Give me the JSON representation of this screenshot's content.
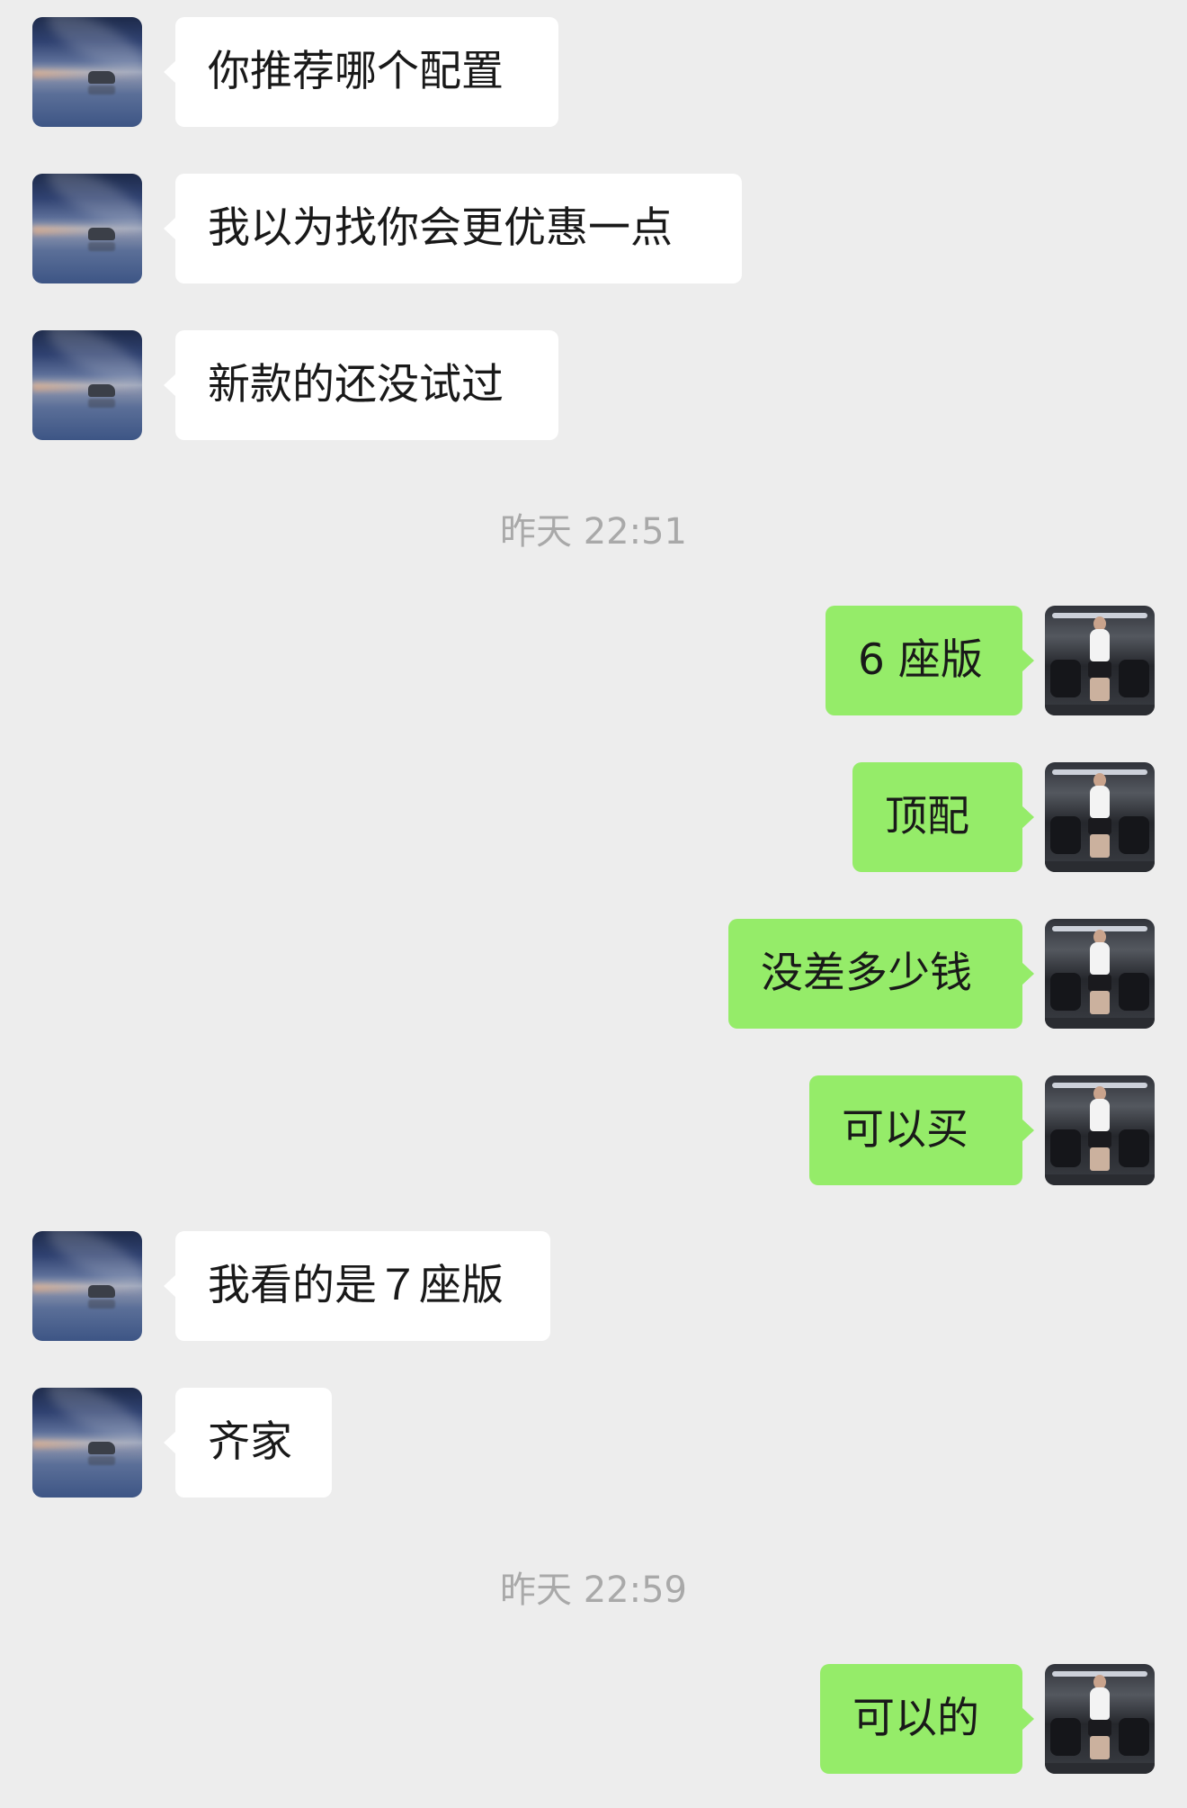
{
  "messages": [
    {
      "side": "in",
      "avatar": "starry-sky-car-avatar",
      "text": "你推荐哪个配置"
    },
    {
      "side": "in",
      "avatar": "starry-sky-car-avatar",
      "text": "我以为找你会更优惠一点"
    },
    {
      "side": "in",
      "avatar": "starry-sky-car-avatar",
      "text": "新款的还没试过"
    },
    {
      "timestamp": "昨天 22:51"
    },
    {
      "side": "out",
      "avatar": "man-in-car-seat-avatar",
      "text": "6 座版"
    },
    {
      "side": "out",
      "avatar": "man-in-car-seat-avatar",
      "text": "顶配"
    },
    {
      "side": "out",
      "avatar": "man-in-car-seat-avatar",
      "text": "没差多少钱"
    },
    {
      "side": "out",
      "avatar": "man-in-car-seat-avatar",
      "text": "可以买"
    },
    {
      "side": "in",
      "avatar": "starry-sky-car-avatar",
      "text": "我看的是７座版"
    },
    {
      "side": "in",
      "avatar": "starry-sky-car-avatar",
      "text": "齐家"
    },
    {
      "timestamp": "昨天 22:59"
    },
    {
      "side": "out",
      "avatar": "man-in-car-seat-avatar",
      "text": "可以的"
    }
  ],
  "colors": {
    "background": "#ededed",
    "incoming_bubble": "#ffffff",
    "outgoing_bubble": "#95ec69",
    "timestamp_text": "#a9a9a9"
  }
}
